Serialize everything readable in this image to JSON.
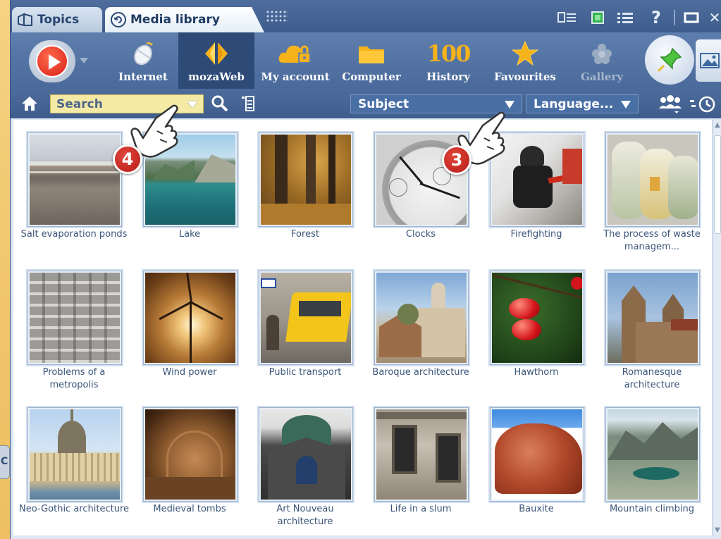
{
  "tabs": [
    {
      "label": "Topics",
      "icon": "topics-icon"
    },
    {
      "label": "Media library",
      "icon": "media-library-icon"
    }
  ],
  "window_controls": [
    "list-view-icon",
    "green-square-icon",
    "list-icon",
    "help-icon",
    "minimize-icon",
    "close-icon"
  ],
  "help_glyph": "?",
  "close_glyph": "✕",
  "toolbar": {
    "items": [
      {
        "label": "Internet",
        "icon": "internet-mouse-icon"
      },
      {
        "label": "mozaWeb",
        "icon": "mozaweb-icon",
        "active": true
      },
      {
        "label": "My account",
        "icon": "cloud-lock-icon"
      },
      {
        "label": "Computer",
        "icon": "folder-icon"
      },
      {
        "label": "History",
        "icon": "history-100-icon",
        "icon_text": "100"
      },
      {
        "label": "Favourites",
        "icon": "star-icon"
      },
      {
        "label": "Gallery",
        "icon": "gallery-icon",
        "disabled": true
      }
    ]
  },
  "filter": {
    "search_placeholder": "Search",
    "subject_label": "Subject",
    "language_label": "Language..."
  },
  "callouts": {
    "search": "4",
    "subject": "3"
  },
  "side_tab_letter": "C",
  "colors": {
    "frame_blue": "#4a6a9b",
    "active_button": "#2e4b78",
    "search_yellow": "#f4eaa6",
    "badge_red": "#c8261e",
    "outer_background": "#f3cd7a"
  },
  "media_items": [
    {
      "caption": "Salt evaporation ponds"
    },
    {
      "caption": "Lake"
    },
    {
      "caption": "Forest"
    },
    {
      "caption": "Clocks"
    },
    {
      "caption": "Firefighting"
    },
    {
      "caption": "The process of waste managem..."
    },
    {
      "caption": "Problems of a metropolis"
    },
    {
      "caption": "Wind power"
    },
    {
      "caption": "Public transport"
    },
    {
      "caption": "Baroque architecture"
    },
    {
      "caption": "Hawthorn"
    },
    {
      "caption": "Romanesque architecture"
    },
    {
      "caption": "Neo-Gothic architecture"
    },
    {
      "caption": "Medieval tombs"
    },
    {
      "caption": "Art Nouveau architecture"
    },
    {
      "caption": "Life in a slum"
    },
    {
      "caption": "Bauxite"
    },
    {
      "caption": "Mountain climbing"
    }
  ]
}
